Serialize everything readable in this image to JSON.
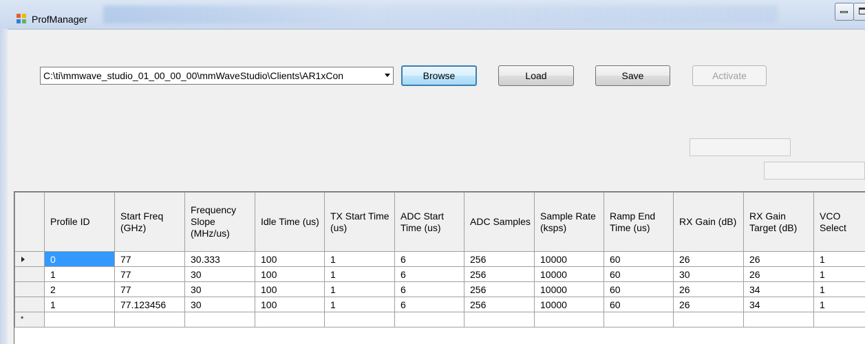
{
  "window": {
    "title": "ProfManager"
  },
  "toolbar": {
    "path_value": "C:\\ti\\mmwave_studio_01_00_00_00\\mmWaveStudio\\Clients\\AR1xCon",
    "browse_label": "Browse",
    "load_label": "Load",
    "save_label": "Save",
    "activate_label": "Activate"
  },
  "grid": {
    "columns": [
      "Profile ID",
      "Start Freq (GHz)",
      "Frequency Slope (MHz/us)",
      "Idle Time (us)",
      "TX Start Time (us)",
      "ADC Start Time (us)",
      "ADC Samples",
      "Sample Rate (ksps)",
      "Ramp End Time (us)",
      "RX Gain (dB)",
      "RX Gain Target (dB)",
      "VCO Select"
    ],
    "rows": [
      [
        "0",
        "77",
        "30.333",
        "100",
        "1",
        "6",
        "256",
        "10000",
        "60",
        "26",
        "26",
        "1"
      ],
      [
        "1",
        "77",
        "30",
        "100",
        "1",
        "6",
        "256",
        "10000",
        "60",
        "30",
        "26",
        "1"
      ],
      [
        "2",
        "77",
        "30",
        "100",
        "1",
        "6",
        "256",
        "10000",
        "60",
        "26",
        "34",
        "1"
      ],
      [
        "1",
        "77.123456",
        "30",
        "100",
        "1",
        "6",
        "256",
        "10000",
        "60",
        "26",
        "34",
        "1"
      ]
    ],
    "new_row_marker": "*"
  }
}
